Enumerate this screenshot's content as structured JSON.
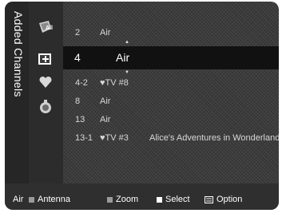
{
  "title": "Added Channels",
  "channels": [
    {
      "number": "2",
      "type": "Air",
      "program": ""
    },
    {
      "number": "4",
      "type": "Air",
      "program": ""
    },
    {
      "number": "4-2",
      "type": "♥TV #8",
      "program": ""
    },
    {
      "number": "8",
      "type": "Air",
      "program": ""
    },
    {
      "number": "13",
      "type": "Air",
      "program": ""
    },
    {
      "number": "13-1",
      "type": "♥TV #3",
      "program": "Alice's Adventures in Wonderland"
    }
  ],
  "side_icons": {
    "all_badge": "All",
    "dot": "•"
  },
  "footer": {
    "source": "Air",
    "antenna": "Antenna",
    "zoom": "Zoom",
    "select": "Select",
    "option": "Option"
  },
  "icons": [
    "all-channels-icon",
    "edit-channel-icon",
    "favorite-heart-icon",
    "programmed-icon",
    "option-icon"
  ]
}
